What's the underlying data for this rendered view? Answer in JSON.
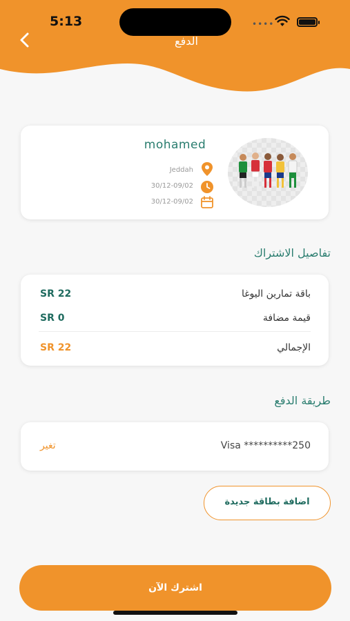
{
  "status_bar": {
    "time": "5:13",
    "dots": "••••"
  },
  "header": {
    "title": "الدفع",
    "brand_color": "#f0932b"
  },
  "profile": {
    "name": "mohamed",
    "city": "Jeddah",
    "time_range": "30/12-09/02",
    "date_range": "30/12-09/02"
  },
  "subscription": {
    "title": "تفاصيل الاشتراك",
    "items": [
      {
        "label": "باقة تمارين اليوغا",
        "value": "SR 22"
      },
      {
        "label": "قيمة مضافة",
        "value": "SR 0"
      }
    ],
    "total": {
      "label": "الإجمالي",
      "value": "SR 22"
    }
  },
  "payment": {
    "title": "طريقة الدفع",
    "card": "Visa **********250",
    "change_label": "تغير",
    "add_card_label": "اضافة بطاقة جديدة"
  },
  "subscribe_label": "اشترك الآن",
  "colors": {
    "accent": "#f0932b",
    "teal": "#1f6b5f"
  }
}
